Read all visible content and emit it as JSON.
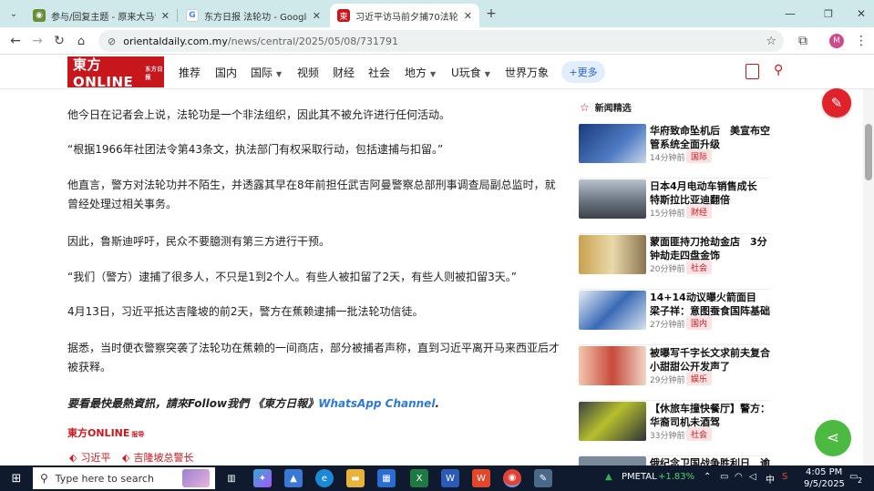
{
  "browser": {
    "tabs": [
      {
        "title": "参与/回复主题 - 原来大马青运报...",
        "active": false
      },
      {
        "title": "东方日报 法轮功 - Google Search",
        "active": false
      },
      {
        "title": "习近平访马前夕捕70法轮功信徒...",
        "active": true
      }
    ],
    "new_tab": "+",
    "address_host": "orientaldaily.com.my",
    "address_path": "/news/central/2025/05/08/731791",
    "profile_initial": "M"
  },
  "site": {
    "logo_text": "東方ONLINE",
    "logo_sub": "东方日报",
    "nav": [
      "推荐",
      "国内",
      "国际",
      "视频",
      "财经",
      "社会",
      "地方",
      "U玩食",
      "世界万象"
    ],
    "nav_dropdowns": [
      "国际",
      "地方",
      "U玩食"
    ],
    "more_label": "+更多"
  },
  "article": {
    "paragraphs": [
      "他今日在记者会上说，法轮功是一个非法组织，因此其不被允许进行任何活动。",
      "“根据1966年社团法令第43条文，执法部门有权采取行动，包括逮捕与扣留。”",
      "他直言，警方对法轮功并不陌生，并透露其早在8年前担任武吉阿曼警察总部刑事调查局副总监时，就曾经处理过相关事务。",
      "因此，鲁斯迪呼吁，民众不要臆测有第三方进行干预。",
      "“我们（警方）逮捕了很多人，不只是1到2个人。有些人被扣留了2天，有些人则被扣留3天。”",
      "4月13日，习近平抵达吉隆坡的前2天，警方在蕉赖逮捕一批法轮功信徒。",
      "据悉，当时便衣警察突袭了法轮功在蕉赖的一间商店，部分被捕者声称，直到习近平离开马来西亚后才被获释。"
    ],
    "whatsapp_prefix": "要看最快最熱資訊，請來Follow我們 《東方日報》",
    "whatsapp_link": "WhatsApp Channel",
    "whatsapp_suffix": ".",
    "source_logo": "東方ONLINE",
    "source_sub": "报导",
    "tags": [
      "习近平",
      "吉隆坡总警长"
    ]
  },
  "sidebar": {
    "heading": "新闻精选",
    "items": [
      {
        "title": "华府致命坠机后　美宣布空管系统全面升级",
        "time": "14分钟前",
        "category": "国际"
      },
      {
        "title": "日本4月电动车销售成长　特斯拉比亚迪翻倍",
        "time": "15分钟前",
        "category": "财经"
      },
      {
        "title": "蒙面匪持刀抢劫金店　3分钟劫走四盘金饰",
        "time": "20分钟前",
        "category": "社会"
      },
      {
        "title": "14+14动议曝火箭面目　梁子祥：意图蚕食国阵基础",
        "time": "27分钟前",
        "category": "国内"
      },
      {
        "title": "被曝写千字长文求前夫复合　小甜甜公开发声了",
        "time": "29分钟前",
        "category": "娱乐"
      },
      {
        "title": "【休旅车撞快餐厅】警方：华裔司机未酒驾",
        "time": "33分钟前",
        "category": "社会"
      },
      {
        "title": "俄纪念卫国战争胜利日　逾",
        "time": "",
        "category": ""
      }
    ]
  },
  "taskbar": {
    "search_placeholder": "Type here to search",
    "ticker_name": "PMETAL",
    "ticker_change": "+1.83%",
    "ime": "中",
    "time": "4:05 PM",
    "date": "9/5/2025",
    "notifications": "2"
  },
  "colors": {
    "brand": "#c8161d",
    "link": "#2e7ad0",
    "share": "#4cba40",
    "pen": "#e0222b"
  }
}
